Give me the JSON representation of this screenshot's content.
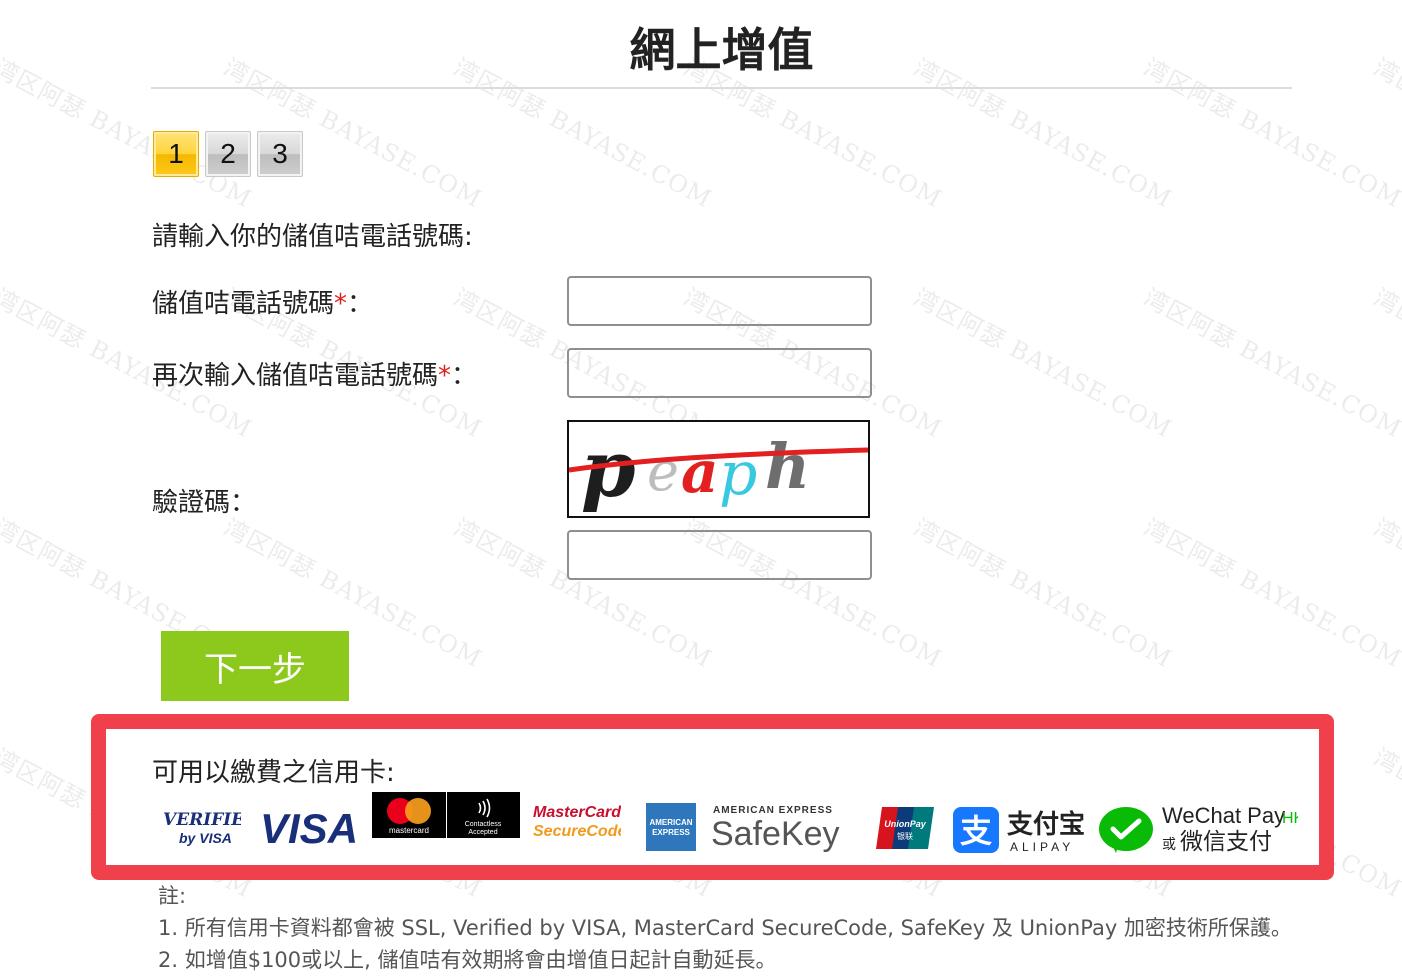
{
  "watermark": {
    "text": "湾区阿瑟 BAYASE.COM"
  },
  "page": {
    "title": "網上增值"
  },
  "steps": [
    {
      "label": "1",
      "active": true
    },
    {
      "label": "2",
      "active": false
    },
    {
      "label": "3",
      "active": false
    }
  ],
  "form": {
    "prompt": "請輸入你的儲值咭電話號碼:",
    "phone_label": "儲值咭電話號碼",
    "phone_confirm_label": "再次輸入儲值咭電話號碼",
    "required_mark": "*",
    "colon": "：",
    "captcha_label": "驗證碼：",
    "captcha_text": "peaph",
    "phone_value": "",
    "phone_confirm_value": "",
    "captcha_value": ""
  },
  "next_button": {
    "label": "下一步",
    "color": "#8cc91c"
  },
  "cards": {
    "title": "可用以繳費之信用卡:",
    "highlight_color": "#f0404b",
    "logos": {
      "verified_by_visa": {
        "line1": "VERIFIED",
        "line2": "by VISA"
      },
      "visa": {
        "text": "VISA"
      },
      "mastercard": {
        "text": "mastercard"
      },
      "contactless": {
        "line1": "Contactless",
        "line2": "Accepted"
      },
      "mastercard_securecode": {
        "line1": "MasterCard.",
        "line2": "SecureCode."
      },
      "amex": {
        "line1": "AMERICAN",
        "line2": "EXPRESS"
      },
      "amex_safekey": {
        "line1": "AMERICAN EXPRESS",
        "line2": "SafeKey"
      },
      "unionpay": {
        "line1": "UnionPay",
        "line2": "银联"
      },
      "alipay": {
        "cn": "支付宝",
        "en": "ALIPAY"
      },
      "wechat_pay": {
        "en": "WeChat Pay",
        "hk": "HK",
        "or": "或",
        "cn": "微信支付"
      }
    }
  },
  "notes": {
    "header": "註:",
    "items": [
      "1. 所有信用卡資料都會被 SSL, Verified by VISA, MasterCard SecureCode, SafeKey 及 UnionPay 加密技術所保護。",
      "2. 如增值$100或以上, 儲值咭有效期將會由增值日起計自動延長。"
    ]
  }
}
